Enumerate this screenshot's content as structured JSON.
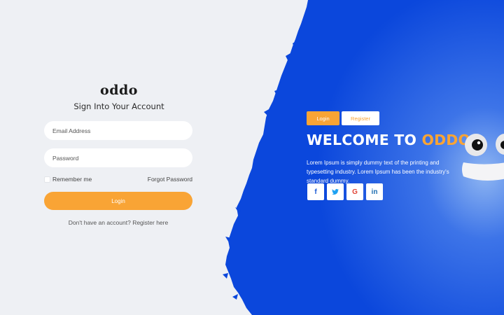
{
  "login_form": {
    "brand": "oddo",
    "subtitle": "Sign Into Your Account",
    "email_placeholder": "Email Address",
    "password_placeholder": "Password",
    "remember_label": "Remember me",
    "forgot_label": "Forgot Password",
    "login_label": "Login",
    "register_prompt": "Don't have an account? Register here"
  },
  "hero": {
    "tabs": [
      {
        "label": "Login",
        "active": true
      },
      {
        "label": "Register",
        "active": false
      }
    ],
    "title_prefix": "WELCOME TO ",
    "title_accent": "ODDO",
    "description": "Lorem Ipsum is simply dummy text of the printing and typesetting industry. Lorem Ipsum has been the industry's standard dummy.",
    "social": [
      {
        "icon": "facebook-icon",
        "glyph": "f"
      },
      {
        "icon": "twitter-icon",
        "glyph": "t"
      },
      {
        "icon": "google-icon",
        "glyph": "G"
      },
      {
        "icon": "linkedin-icon",
        "glyph": "in"
      }
    ]
  },
  "colors": {
    "accent": "#f9a435",
    "panel_blue": "#1a4fdc",
    "background": "#eef0f4"
  }
}
